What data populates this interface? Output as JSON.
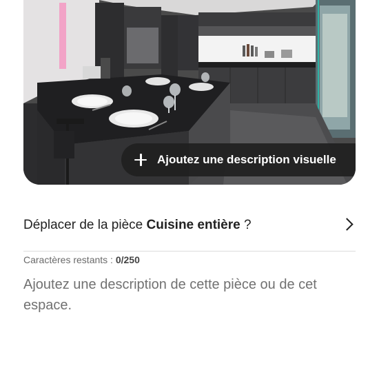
{
  "photo": {
    "alt_subject": "kitchen-photo",
    "add_description_label": "Ajoutez une description visuelle"
  },
  "move_row": {
    "prefix": "Déplacer de la pièce ",
    "room_name": "Cuisine entière",
    "suffix": " ?"
  },
  "counter": {
    "label": "Caractères restants : ",
    "count": "0/250"
  },
  "description": {
    "placeholder": "Ajoutez une description de cette pièce ou de cet espace.",
    "value": ""
  },
  "colors": {
    "text_primary": "#222222",
    "text_secondary": "#717171",
    "divider": "#dddddd",
    "button_bg": "#202020"
  },
  "icons": {
    "add": "plus-icon",
    "navigate": "chevron-right-icon"
  }
}
